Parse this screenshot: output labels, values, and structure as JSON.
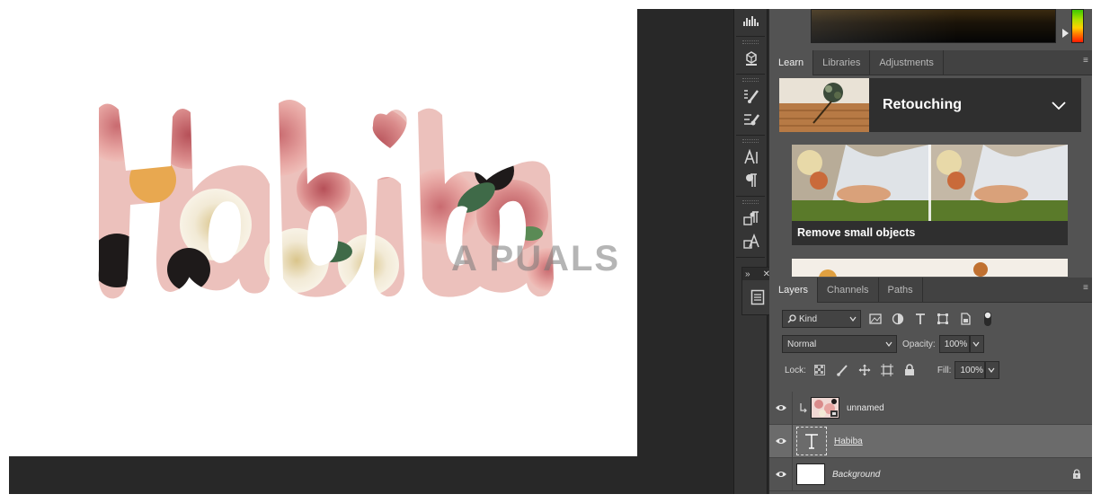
{
  "canvas": {
    "text_art": "Habiba",
    "watermark": "A  PUALS"
  },
  "learn_panel": {
    "tabs": [
      "Learn",
      "Libraries",
      "Adjustments"
    ],
    "active_tab": "Learn",
    "section_title": "Retouching",
    "tutorial_label": "Remove small objects"
  },
  "layers_panel": {
    "tabs": [
      "Layers",
      "Channels",
      "Paths"
    ],
    "active_tab": "Layers",
    "filter_label": "Kind",
    "blend_mode": "Normal",
    "opacity_label": "Opacity:",
    "opacity_value": "100%",
    "lock_label": "Lock:",
    "fill_label": "Fill:",
    "fill_value": "100%",
    "layers": [
      {
        "name": "unnamed",
        "type": "image",
        "clipped": true,
        "visible": true,
        "selected": false
      },
      {
        "name": "Habiba",
        "type": "text",
        "clipped": false,
        "visible": true,
        "selected": true
      },
      {
        "name": "Background",
        "type": "fill",
        "clipped": false,
        "visible": true,
        "selected": false,
        "locked": true
      }
    ]
  },
  "colors": {
    "panel_bg": "#535353",
    "app_bg": "#282828",
    "selected_row": "#6b6b6b"
  }
}
